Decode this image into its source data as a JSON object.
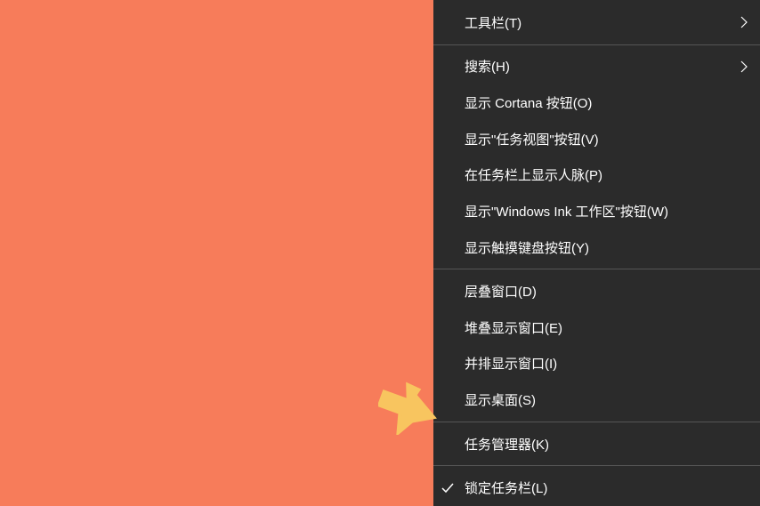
{
  "menu": {
    "groups": [
      [
        {
          "label": "工具栏(T)",
          "submenu": true,
          "checked": false
        }
      ],
      [
        {
          "label": "搜索(H)",
          "submenu": true,
          "checked": false
        },
        {
          "label": "显示 Cortana 按钮(O)",
          "submenu": false,
          "checked": false
        },
        {
          "label": "显示\"任务视图\"按钮(V)",
          "submenu": false,
          "checked": false
        },
        {
          "label": "在任务栏上显示人脉(P)",
          "submenu": false,
          "checked": false
        },
        {
          "label": "显示\"Windows Ink 工作区\"按钮(W)",
          "submenu": false,
          "checked": false
        },
        {
          "label": "显示触摸键盘按钮(Y)",
          "submenu": false,
          "checked": false
        }
      ],
      [
        {
          "label": "层叠窗口(D)",
          "submenu": false,
          "checked": false
        },
        {
          "label": "堆叠显示窗口(E)",
          "submenu": false,
          "checked": false
        },
        {
          "label": "并排显示窗口(I)",
          "submenu": false,
          "checked": false
        },
        {
          "label": "显示桌面(S)",
          "submenu": false,
          "checked": false
        }
      ],
      [
        {
          "label": "任务管理器(K)",
          "submenu": false,
          "checked": false
        }
      ],
      [
        {
          "label": "锁定任务栏(L)",
          "submenu": false,
          "checked": true
        }
      ]
    ]
  },
  "colors": {
    "desktop": "#f77c5a",
    "menu_bg": "#2b2b2b",
    "arrow": "#f8c55f"
  }
}
